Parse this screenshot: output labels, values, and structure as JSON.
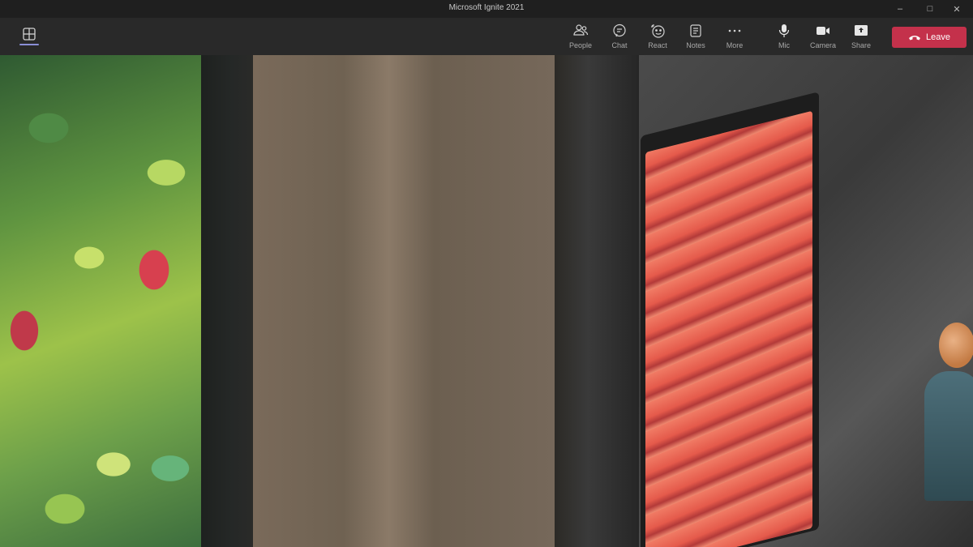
{
  "window": {
    "title": "Microsoft Ignite 2021",
    "controls": {
      "minimize": "–",
      "maximize": "□",
      "close": "✕"
    }
  },
  "toolbar": {
    "people_label": "People",
    "chat_label": "Chat",
    "react_label": "React",
    "notes_label": "Notes",
    "more_label": "More",
    "mic_label": "Mic",
    "camera_label": "Camera",
    "share_label": "Share",
    "leave_label": "Leave"
  },
  "colors": {
    "leave_button": "#c4314b",
    "toolbar_bg": "#292929",
    "titlebar_bg": "#1f1f1f",
    "view_indicator": "#8a8fd6"
  },
  "icons": [
    "grid-view-icon",
    "people-icon",
    "chat-icon",
    "react-icon",
    "notes-icon",
    "more-icon",
    "mic-icon",
    "camera-icon",
    "share-icon",
    "phone-hangup-icon"
  ]
}
